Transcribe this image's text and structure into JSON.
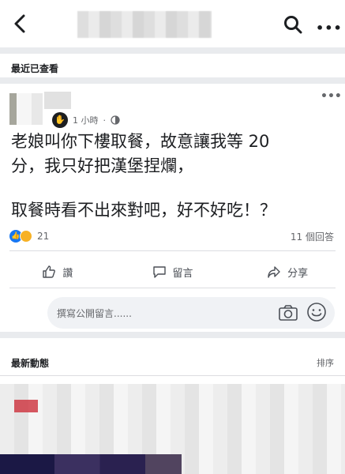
{
  "header": {
    "back_icon": "chevron-left-icon",
    "search_icon": "search-icon",
    "more_icon": "more-horizontal-icon"
  },
  "recent": {
    "section_label": "最近已查看"
  },
  "post": {
    "time": "1 小時",
    "privacy_icon": "globe-icon",
    "badge_icon": "wave-hand-icon",
    "more_label": "•••",
    "text_line1": "老娘叫你下樓取餐，故意讓我等 20",
    "text_line2": "分，我只好把漢堡捏爛，",
    "text_line3": "取餐時看不出來對吧，好不好吃！？",
    "reaction_count": "21",
    "comment_count": "11 個回答",
    "actions": {
      "like": "讚",
      "comment": "留言",
      "share": "分享"
    },
    "composer_placeholder": "撰寫公開留言......"
  },
  "feed": {
    "section_label": "最新動態",
    "sort_label": "排序"
  },
  "colors": {
    "accent": "#1877f2",
    "haha": "#f7b125",
    "separator": "#e9ebee"
  }
}
